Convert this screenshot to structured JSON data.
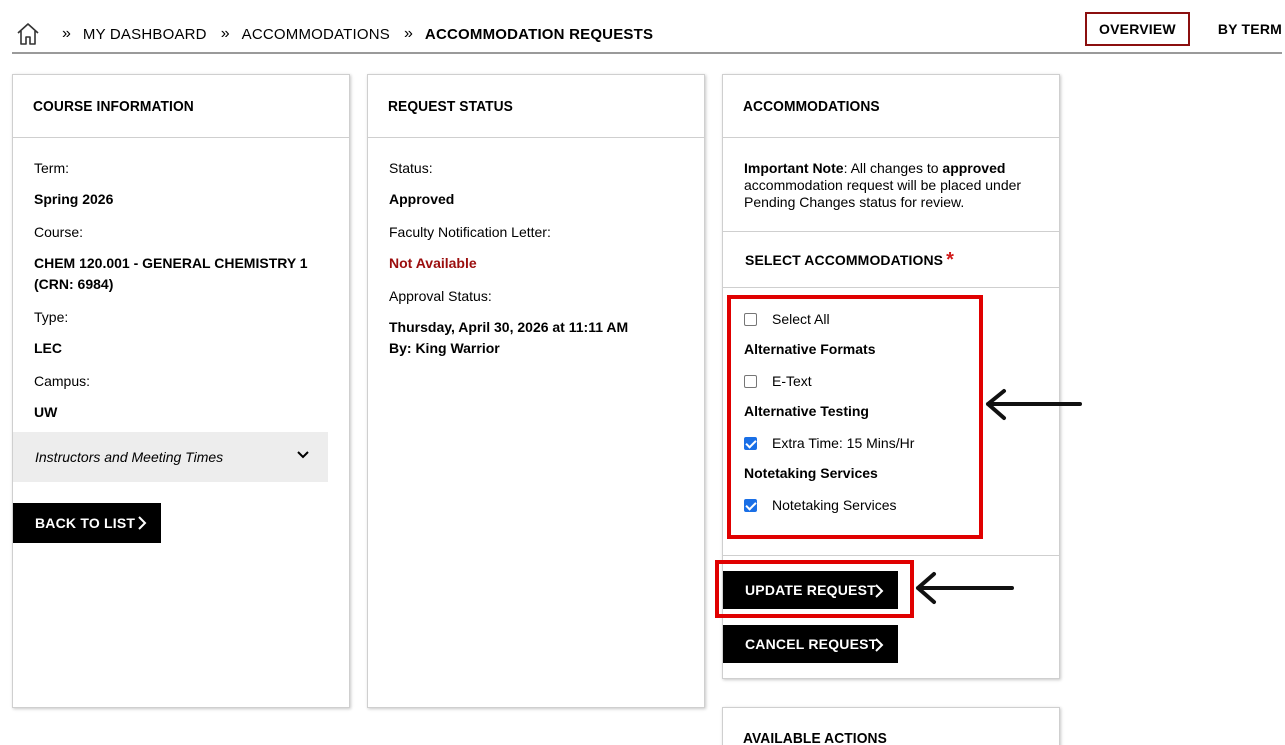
{
  "breadcrumb": {
    "items": [
      "MY DASHBOARD",
      "ACCOMMODATIONS",
      "ACCOMMODATION REQUESTS"
    ]
  },
  "view_tabs": {
    "overview": "OVERVIEW",
    "by_term": "BY TERM"
  },
  "course_info": {
    "title": "COURSE INFORMATION",
    "term_label": "Term:",
    "term_value": "Spring 2026",
    "course_label": "Course:",
    "course_value_line1": "CHEM 120.001 - GENERAL CHEMISTRY 1",
    "course_value_line2": "(CRN: 6984)",
    "type_label": "Type:",
    "type_value": "LEC",
    "campus_label": "Campus:",
    "campus_value": "UW",
    "instructors_label": "Instructors and Meeting Times",
    "back_label": "BACK TO LIST"
  },
  "request_status": {
    "title": "REQUEST STATUS",
    "status_label": "Status:",
    "status_value": "Approved",
    "letter_label": "Faculty Notification Letter:",
    "letter_value": "Not Available",
    "approval_label": "Approval Status:",
    "approval_line1": "Thursday, April 30, 2026 at 11:11 AM",
    "approval_line2": "By: King Warrior"
  },
  "accommodations": {
    "title": "ACCOMMODATIONS",
    "note_bold": "Important Note",
    "note_text1": ": All changes to ",
    "note_bold2": "approved",
    "note_text2": " accommodation request will be placed under Pending Changes status for review.",
    "select_heading": "SELECT ACCOMMODATIONS",
    "required_mark": "*",
    "select_all": "Select All",
    "groups": [
      {
        "label": "Alternative Formats",
        "option": "E-Text",
        "checked": false
      },
      {
        "label": "Alternative Testing",
        "option": "Extra Time: 15 Mins/Hr",
        "checked": true
      },
      {
        "label": "Notetaking Services",
        "option": "Notetaking Services",
        "checked": true
      }
    ],
    "update_label": "UPDATE REQUEST",
    "cancel_label": "CANCEL REQUEST"
  },
  "available_actions": {
    "title": "AVAILABLE ACTIONS"
  },
  "colors": {
    "accent_red": "#8b0f0f",
    "error_red": "#9b0d0d",
    "annotation_red": "#e00000",
    "checkbox_blue": "#1a6fe6"
  }
}
